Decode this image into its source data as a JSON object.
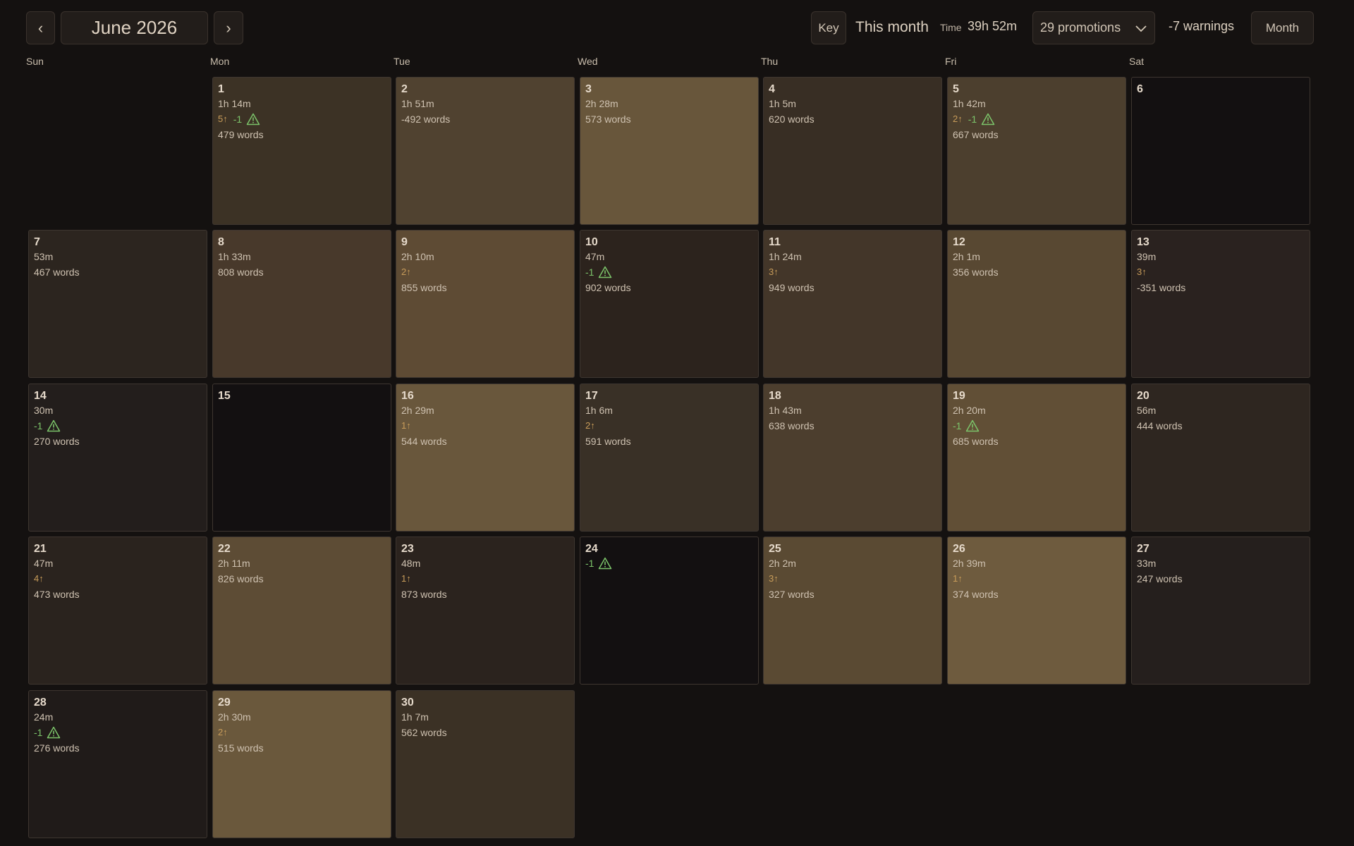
{
  "header": {
    "prev_label": "‹",
    "month_title": "June 2026",
    "next_label": "›",
    "key_label": "Key",
    "scope_label": "This month",
    "time_label": "Time",
    "time_value": "39h 52m",
    "promotions_label": "29 promotions",
    "warnings_label": "-7 warnings",
    "view_label": "Month"
  },
  "colors": {
    "background": "#141110",
    "warning": "#7cc46a",
    "promotion": "#c89c5a"
  },
  "weekdays": [
    "Sun",
    "Mon",
    "Tue",
    "Wed",
    "Thu",
    "Fri",
    "Sat"
  ],
  "days": [
    {
      "day": "1",
      "time": "1h 14m",
      "promo": "5↑",
      "warn": "-1",
      "words": "479 words",
      "bg": "#3c3225"
    },
    {
      "day": "2",
      "time": "1h 51m",
      "promo": "",
      "warn": "",
      "words": "-492 words",
      "bg": "#504230"
    },
    {
      "day": "3",
      "time": "2h 28m",
      "promo": "",
      "warn": "",
      "words": "573 words",
      "bg": "#68563b"
    },
    {
      "day": "4",
      "time": "1h 5m",
      "promo": "",
      "warn": "",
      "words": "620 words",
      "bg": "#382e24"
    },
    {
      "day": "5",
      "time": "1h 42m",
      "promo": "2↑",
      "warn": "-1",
      "words": "667 words",
      "bg": "#4c3f2e"
    },
    {
      "day": "6",
      "time": "",
      "promo": "",
      "warn": "",
      "words": "",
      "bg": "#131011"
    },
    {
      "day": "7",
      "time": "53m",
      "promo": "",
      "warn": "",
      "words": "467 words",
      "bg": "#2c251f"
    },
    {
      "day": "8",
      "time": "1h 33m",
      "promo": "",
      "warn": "",
      "words": "808 words",
      "bg": "#48392b"
    },
    {
      "day": "9",
      "time": "2h 10m",
      "promo": "2↑",
      "warn": "",
      "words": "855 words",
      "bg": "#5e4b34"
    },
    {
      "day": "10",
      "time": "47m",
      "promo": "",
      "warn": "-1",
      "words": "902 words",
      "bg": "#2c231d"
    },
    {
      "day": "11",
      "time": "1h 24m",
      "promo": "3↑",
      "warn": "",
      "words": "949 words",
      "bg": "#433629"
    },
    {
      "day": "12",
      "time": "2h 1m",
      "promo": "",
      "warn": "",
      "words": "356 words",
      "bg": "#584832"
    },
    {
      "day": "13",
      "time": "39m",
      "promo": "3↑",
      "warn": "",
      "words": "-351 words",
      "bg": "#2a221f"
    },
    {
      "day": "14",
      "time": "30m",
      "promo": "",
      "warn": "-1",
      "words": "270 words",
      "bg": "#231e1c"
    },
    {
      "day": "15",
      "time": "",
      "promo": "",
      "warn": "",
      "words": "",
      "bg": "#131011"
    },
    {
      "day": "16",
      "time": "2h 29m",
      "promo": "1↑",
      "warn": "",
      "words": "544 words",
      "bg": "#69573c"
    },
    {
      "day": "17",
      "time": "1h 6m",
      "promo": "2↑",
      "warn": "",
      "words": "591 words",
      "bg": "#393026"
    },
    {
      "day": "18",
      "time": "1h 43m",
      "promo": "",
      "warn": "",
      "words": "638 words",
      "bg": "#4c3e2e"
    },
    {
      "day": "19",
      "time": "2h 20m",
      "promo": "",
      "warn": "-1",
      "words": "685 words",
      "bg": "#614f36"
    },
    {
      "day": "20",
      "time": "56m",
      "promo": "",
      "warn": "",
      "words": "444 words",
      "bg": "#2e2620"
    },
    {
      "day": "21",
      "time": "47m",
      "promo": "4↑",
      "warn": "",
      "words": "473 words",
      "bg": "#2a231e"
    },
    {
      "day": "22",
      "time": "2h 11m",
      "promo": "",
      "warn": "",
      "words": "826 words",
      "bg": "#5d4c35"
    },
    {
      "day": "23",
      "time": "48m",
      "promo": "1↑",
      "warn": "",
      "words": "873 words",
      "bg": "#2b231e"
    },
    {
      "day": "24",
      "time": "",
      "promo": "",
      "warn": "-1",
      "words": "",
      "bg": "#131011"
    },
    {
      "day": "25",
      "time": "2h 2m",
      "promo": "3↑",
      "warn": "",
      "words": "327 words",
      "bg": "#5a4a33"
    },
    {
      "day": "26",
      "time": "2h 39m",
      "promo": "1↑",
      "warn": "",
      "words": "374 words",
      "bg": "#6e5b3e"
    },
    {
      "day": "27",
      "time": "33m",
      "promo": "",
      "warn": "",
      "words": "247 words",
      "bg": "#251f1d"
    },
    {
      "day": "28",
      "time": "24m",
      "promo": "",
      "warn": "-1",
      "words": "276 words",
      "bg": "#201b19"
    },
    {
      "day": "29",
      "time": "2h 30m",
      "promo": "2↑",
      "warn": "",
      "words": "515 words",
      "bg": "#6a583c"
    },
    {
      "day": "30",
      "time": "1h 7m",
      "promo": "",
      "warn": "",
      "words": "562 words",
      "bg": "#3b3125"
    }
  ]
}
